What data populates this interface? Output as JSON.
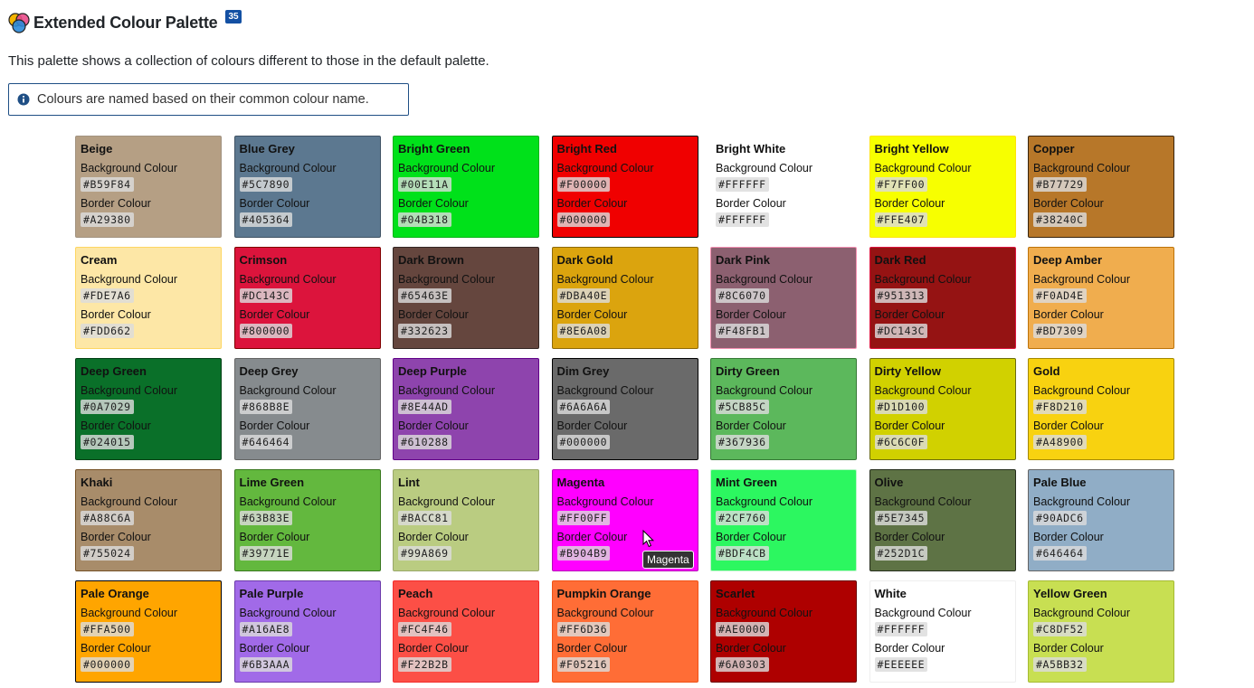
{
  "header": {
    "title": "Extended Colour Palette",
    "count_badge": "35"
  },
  "description": "This palette shows a collection of colours different to those in the default palette.",
  "info_alert": "Colours are named based on their common colour name.",
  "labels": {
    "background": "Background Colour",
    "border": "Border Colour"
  },
  "colours": [
    {
      "name": "Beige",
      "bg": "#B59F84",
      "border": "#A29380",
      "text": "#111111"
    },
    {
      "name": "Blue Grey",
      "bg": "#5C7890",
      "border": "#405364",
      "text": "#111111"
    },
    {
      "name": "Bright Green",
      "bg": "#00E11A",
      "border": "#04B318",
      "text": "#111111"
    },
    {
      "name": "Bright Red",
      "bg": "#F00000",
      "border": "#000000",
      "text": "#111111"
    },
    {
      "name": "Bright White",
      "bg": "#FFFFFF",
      "border": "#FFFFFF",
      "text": "#111111"
    },
    {
      "name": "Bright Yellow",
      "bg": "#F7FF00",
      "border": "#FFE407",
      "text": "#111111"
    },
    {
      "name": "Copper",
      "bg": "#B77729",
      "border": "#38240C",
      "text": "#111111"
    },
    {
      "name": "Cream",
      "bg": "#FDE7A6",
      "border": "#FDD662",
      "text": "#111111"
    },
    {
      "name": "Crimson",
      "bg": "#DC143C",
      "border": "#800000",
      "text": "#111111"
    },
    {
      "name": "Dark Brown",
      "bg": "#65463E",
      "border": "#332623",
      "text": "#111111"
    },
    {
      "name": "Dark Gold",
      "bg": "#DBA40E",
      "border": "#8E6A08",
      "text": "#111111"
    },
    {
      "name": "Dark Pink",
      "bg": "#8C6070",
      "border": "#F48FB1",
      "text": "#111111"
    },
    {
      "name": "Dark Red",
      "bg": "#951313",
      "border": "#DC143C",
      "text": "#111111"
    },
    {
      "name": "Deep Amber",
      "bg": "#F0AD4E",
      "border": "#BD7309",
      "text": "#111111"
    },
    {
      "name": "Deep Green",
      "bg": "#0A7029",
      "border": "#024015",
      "text": "#111111"
    },
    {
      "name": "Deep Grey",
      "bg": "#868B8E",
      "border": "#646464",
      "text": "#111111"
    },
    {
      "name": "Deep Purple",
      "bg": "#8E44AD",
      "border": "#610288",
      "text": "#111111"
    },
    {
      "name": "Dim Grey",
      "bg": "#6A6A6A",
      "border": "#000000",
      "text": "#111111"
    },
    {
      "name": "Dirty Green",
      "bg": "#5CB85C",
      "border": "#367936",
      "text": "#111111"
    },
    {
      "name": "Dirty Yellow",
      "bg": "#D1D100",
      "border": "#6C6C0F",
      "text": "#111111"
    },
    {
      "name": "Gold",
      "bg": "#F8D210",
      "border": "#A48900",
      "text": "#111111"
    },
    {
      "name": "Khaki",
      "bg": "#A88C6A",
      "border": "#755024",
      "text": "#111111"
    },
    {
      "name": "Lime Green",
      "bg": "#63B83E",
      "border": "#39771E",
      "text": "#111111"
    },
    {
      "name": "Lint",
      "bg": "#BACC81",
      "border": "#99A869",
      "text": "#111111"
    },
    {
      "name": "Magenta",
      "bg": "#FF00FF",
      "border": "#B904B9",
      "text": "#111111"
    },
    {
      "name": "Mint Green",
      "bg": "#2CF760",
      "border": "#BDF4CB",
      "text": "#111111"
    },
    {
      "name": "Olive",
      "bg": "#5E7345",
      "border": "#252D1C",
      "text": "#111111"
    },
    {
      "name": "Pale Blue",
      "bg": "#90ADC6",
      "border": "#646464",
      "text": "#111111"
    },
    {
      "name": "Pale Orange",
      "bg": "#FFA500",
      "border": "#000000",
      "text": "#111111"
    },
    {
      "name": "Pale Purple",
      "bg": "#A16AE8",
      "border": "#6B3AAA",
      "text": "#111111"
    },
    {
      "name": "Peach",
      "bg": "#FC4F46",
      "border": "#F22B2B",
      "text": "#111111"
    },
    {
      "name": "Pumpkin Orange",
      "bg": "#FF6D36",
      "border": "#F05216",
      "text": "#111111"
    },
    {
      "name": "Scarlet",
      "bg": "#AE0000",
      "border": "#6A0303",
      "text": "#111111"
    },
    {
      "name": "White",
      "bg": "#FFFFFF",
      "border": "#EEEEEE",
      "text": "#111111"
    },
    {
      "name": "Yellow Green",
      "bg": "#C8DF52",
      "border": "#A5BB32",
      "text": "#111111"
    }
  ],
  "tooltip": "Magenta"
}
